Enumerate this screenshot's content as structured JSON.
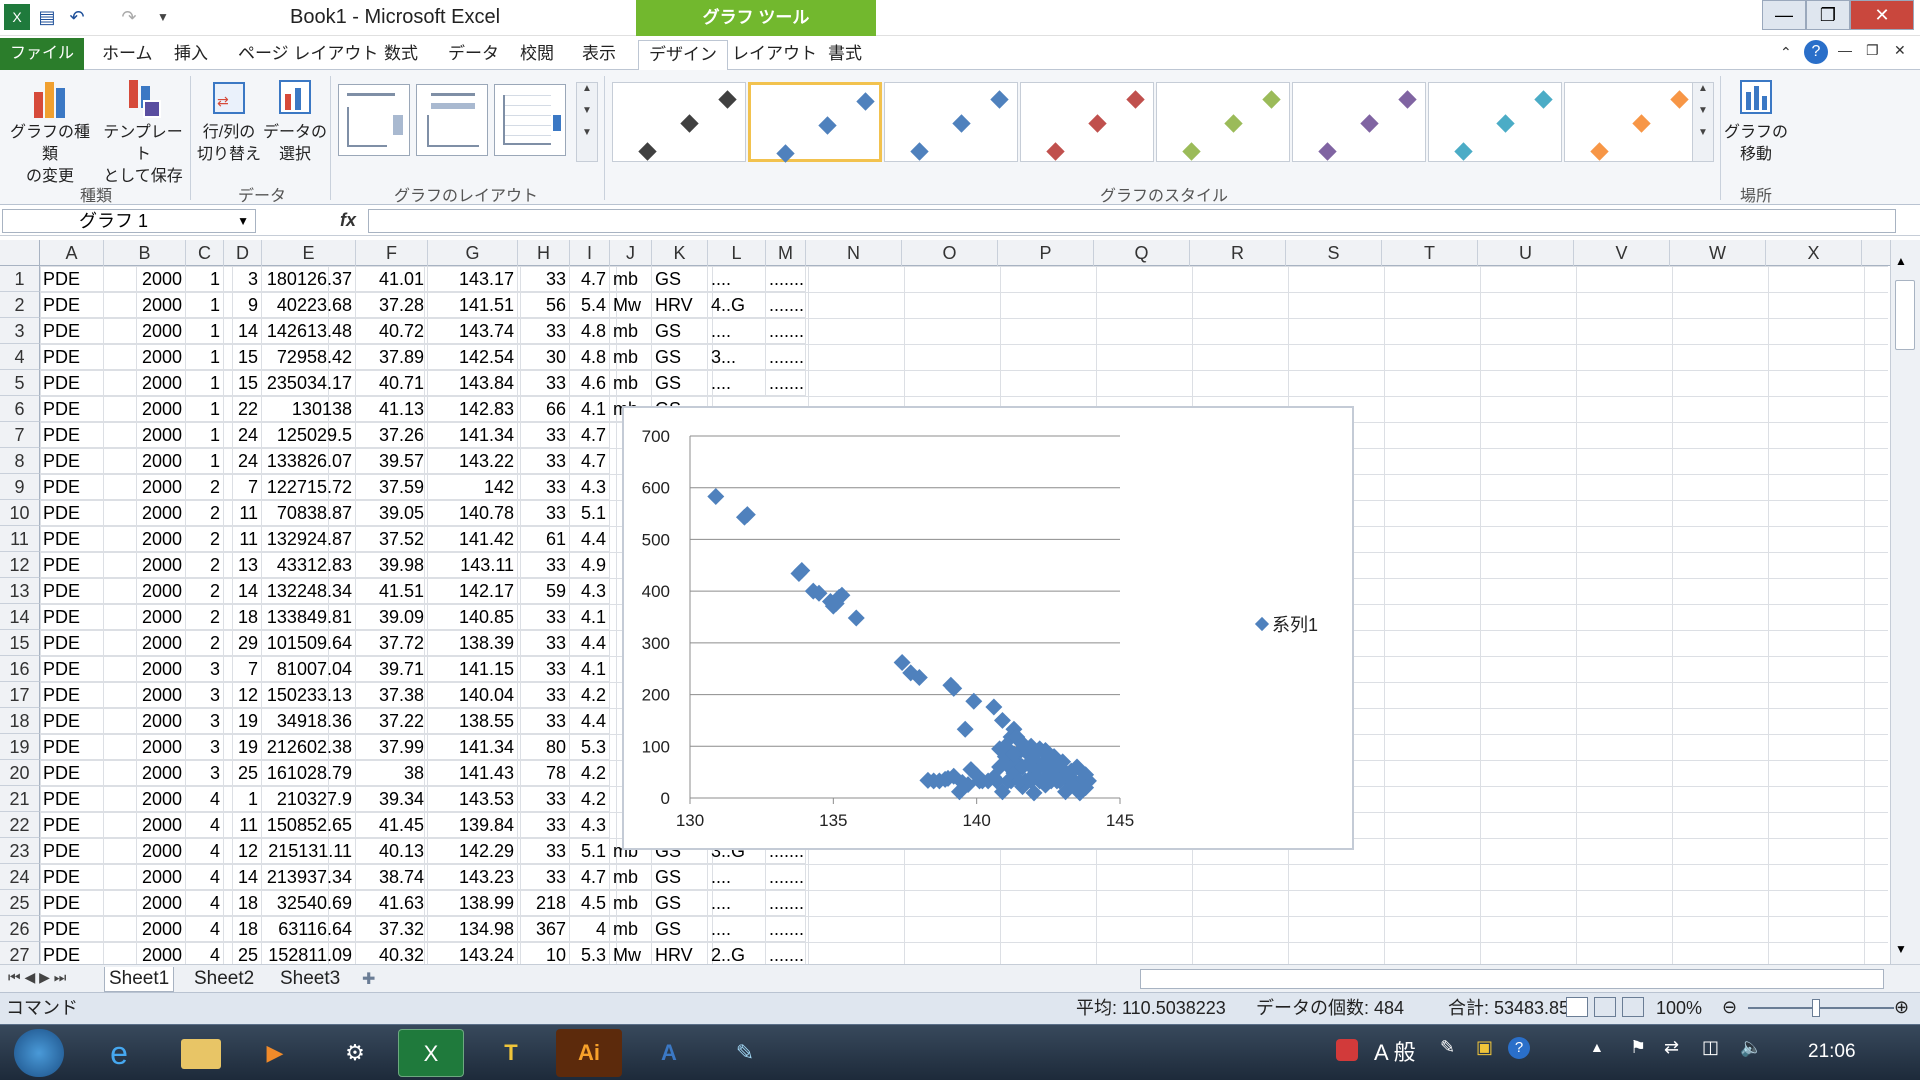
{
  "window": {
    "title": "Book1 - Microsoft Excel",
    "context_tab": "グラフ ツール"
  },
  "tabs": [
    "ファイル",
    "ホーム",
    "挿入",
    "ページ レイアウト",
    "数式",
    "データ",
    "校閲",
    "表示",
    "デザイン",
    "レイアウト",
    "書式"
  ],
  "ribbon": {
    "change_type": [
      "グラフの種類",
      "の変更"
    ],
    "save_template": [
      "テンプレート",
      "として保存"
    ],
    "switch_rowcol": [
      "行/列の",
      "切り替え"
    ],
    "select_data": [
      "データの",
      "選択"
    ],
    "move_chart": [
      "グラフの",
      "移動"
    ],
    "groups": {
      "type": "種類",
      "data": "データ",
      "layout": "グラフのレイアウト",
      "style": "グラフのスタイル",
      "location": "場所"
    },
    "style_colors": [
      "#404040",
      "#4f81bd",
      "#4f81bd",
      "#c0504d",
      "#9bbb59",
      "#8064a2",
      "#4bacc6",
      "#f79646"
    ]
  },
  "formula_bar": {
    "name_box": "グラフ 1",
    "fx": "fx"
  },
  "columns": [
    "A",
    "B",
    "C",
    "D",
    "E",
    "F",
    "G",
    "H",
    "I",
    "J",
    "K",
    "L",
    "M",
    "N",
    "O",
    "P",
    "Q",
    "R",
    "S",
    "T",
    "U",
    "V",
    "W",
    "X"
  ],
  "rows": [
    [
      "PDE",
      "2000",
      "1",
      "3",
      "180126.37",
      "41.01",
      "143.17",
      "33",
      "4.7",
      "mb",
      "GS",
      "....",
      "......."
    ],
    [
      "PDE",
      "2000",
      "1",
      "9",
      "40223.68",
      "37.28",
      "141.51",
      "56",
      "5.4",
      "Mw",
      "HRV",
      "4..G",
      "......."
    ],
    [
      "PDE",
      "2000",
      "1",
      "14",
      "142613.48",
      "40.72",
      "143.74",
      "33",
      "4.8",
      "mb",
      "GS",
      "....",
      "......."
    ],
    [
      "PDE",
      "2000",
      "1",
      "15",
      "72958.42",
      "37.89",
      "142.54",
      "30",
      "4.8",
      "mb",
      "GS",
      "3...",
      "......."
    ],
    [
      "PDE",
      "2000",
      "1",
      "15",
      "235034.17",
      "40.71",
      "143.84",
      "33",
      "4.6",
      "mb",
      "GS",
      "....",
      "......."
    ],
    [
      "PDE",
      "2000",
      "1",
      "22",
      "130138",
      "41.13",
      "142.83",
      "66",
      "4.1",
      "mb",
      "GS",
      "",
      ""
    ],
    [
      "PDE",
      "2000",
      "1",
      "24",
      "125029.5",
      "37.26",
      "141.34",
      "33",
      "4.7",
      "",
      "",
      "",
      ""
    ],
    [
      "PDE",
      "2000",
      "1",
      "24",
      "133826.07",
      "39.57",
      "143.22",
      "33",
      "4.7",
      "",
      "",
      "",
      ""
    ],
    [
      "PDE",
      "2000",
      "2",
      "7",
      "122715.72",
      "37.59",
      "142",
      "33",
      "4.3",
      "",
      "",
      "",
      ""
    ],
    [
      "PDE",
      "2000",
      "2",
      "11",
      "70838.87",
      "39.05",
      "140.78",
      "33",
      "5.1",
      "",
      "",
      "",
      ""
    ],
    [
      "PDE",
      "2000",
      "2",
      "11",
      "132924.87",
      "37.52",
      "141.42",
      "61",
      "4.4",
      "",
      "",
      "",
      ""
    ],
    [
      "PDE",
      "2000",
      "2",
      "13",
      "43312.83",
      "39.98",
      "143.11",
      "33",
      "4.9",
      "",
      "",
      "",
      ""
    ],
    [
      "PDE",
      "2000",
      "2",
      "14",
      "132248.34",
      "41.51",
      "142.17",
      "59",
      "4.3",
      "",
      "",
      "",
      ""
    ],
    [
      "PDE",
      "2000",
      "2",
      "18",
      "133849.81",
      "39.09",
      "140.85",
      "33",
      "4.1",
      "",
      "",
      "",
      ""
    ],
    [
      "PDE",
      "2000",
      "2",
      "29",
      "101509.64",
      "37.72",
      "138.39",
      "33",
      "4.4",
      "",
      "",
      "",
      ""
    ],
    [
      "PDE",
      "2000",
      "3",
      "7",
      "81007.04",
      "39.71",
      "141.15",
      "33",
      "4.1",
      "",
      "",
      "",
      ""
    ],
    [
      "PDE",
      "2000",
      "3",
      "12",
      "150233.13",
      "37.38",
      "140.04",
      "33",
      "4.2",
      "",
      "",
      "",
      ""
    ],
    [
      "PDE",
      "2000",
      "3",
      "19",
      "34918.36",
      "37.22",
      "138.55",
      "33",
      "4.4",
      "",
      "",
      "",
      ""
    ],
    [
      "PDE",
      "2000",
      "3",
      "19",
      "212602.38",
      "37.99",
      "141.34",
      "80",
      "5.3",
      "",
      "",
      "",
      ""
    ],
    [
      "PDE",
      "2000",
      "3",
      "25",
      "161028.79",
      "38",
      "141.43",
      "78",
      "4.2",
      "",
      "",
      "",
      ""
    ],
    [
      "PDE",
      "2000",
      "4",
      "1",
      "210327.9",
      "39.34",
      "143.53",
      "33",
      "4.2",
      "",
      "",
      "",
      ""
    ],
    [
      "PDE",
      "2000",
      "4",
      "11",
      "150852.65",
      "41.45",
      "139.84",
      "33",
      "4.3",
      "",
      "",
      "",
      ""
    ],
    [
      "PDE",
      "2000",
      "4",
      "12",
      "215131.11",
      "40.13",
      "142.29",
      "33",
      "5.1",
      "mb",
      "GS",
      "3..G",
      "......."
    ],
    [
      "PDE",
      "2000",
      "4",
      "14",
      "213937.34",
      "38.74",
      "143.23",
      "33",
      "4.7",
      "mb",
      "GS",
      "....",
      "......."
    ],
    [
      "PDE",
      "2000",
      "4",
      "18",
      "32540.69",
      "41.63",
      "138.99",
      "218",
      "4.5",
      "mb",
      "GS",
      "....",
      "......."
    ],
    [
      "PDE",
      "2000",
      "4",
      "18",
      "63116.64",
      "37.32",
      "134.98",
      "367",
      "4",
      "mb",
      "GS",
      "....",
      "......."
    ],
    [
      "PDE",
      "2000",
      "4",
      "25",
      "152811.09",
      "40.32",
      "143.24",
      "10",
      "5.3",
      "Mw",
      "HRV",
      "2..G",
      "......."
    ]
  ],
  "chart_data": {
    "type": "scatter",
    "xlim": [
      130,
      145
    ],
    "ylim": [
      0,
      700
    ],
    "xticks": [
      "130",
      "135",
      "140",
      "145"
    ],
    "yticks": [
      "0",
      "100",
      "200",
      "300",
      "400",
      "500",
      "600",
      "700"
    ],
    "grid": "horizontal",
    "legend_position": "right",
    "color": "#4f81bd",
    "series": [
      {
        "name": "系列1",
        "points": [
          [
            130.9,
            583
          ],
          [
            131.9,
            543
          ],
          [
            132.0,
            548
          ],
          [
            133.8,
            434
          ],
          [
            133.9,
            440
          ],
          [
            134.3,
            400
          ],
          [
            134.5,
            396
          ],
          [
            134.9,
            380
          ],
          [
            135.0,
            371
          ],
          [
            135.1,
            376
          ],
          [
            135.2,
            388
          ],
          [
            135.3,
            392
          ],
          [
            135.8,
            348
          ],
          [
            137.4,
            262
          ],
          [
            137.7,
            242
          ],
          [
            138.0,
            233
          ],
          [
            139.1,
            218
          ],
          [
            139.2,
            212
          ],
          [
            139.9,
            187
          ],
          [
            139.6,
            133
          ],
          [
            140.6,
            176
          ],
          [
            140.9,
            150
          ],
          [
            141.3,
            133
          ],
          [
            141.5,
            110
          ],
          [
            141.2,
            118
          ],
          [
            138.3,
            34
          ],
          [
            138.5,
            33
          ],
          [
            138.7,
            33
          ],
          [
            138.9,
            36
          ],
          [
            139.0,
            38
          ],
          [
            139.2,
            42
          ],
          [
            139.5,
            30
          ],
          [
            139.8,
            55
          ],
          [
            140.0,
            44
          ],
          [
            140.2,
            33
          ],
          [
            139.4,
            12
          ],
          [
            139.7,
            26
          ],
          [
            140.6,
            40
          ],
          [
            140.8,
            95
          ],
          [
            141.0,
            80
          ],
          [
            141.1,
            62
          ],
          [
            141.2,
            33
          ],
          [
            141.3,
            48
          ],
          [
            141.4,
            70
          ],
          [
            141.5,
            90
          ],
          [
            141.6,
            60
          ],
          [
            141.7,
            33
          ],
          [
            141.8,
            85
          ],
          [
            141.9,
            40
          ],
          [
            142.0,
            75
          ],
          [
            142.1,
            55
          ],
          [
            142.2,
            33
          ],
          [
            142.3,
            66
          ],
          [
            142.4,
            92
          ],
          [
            142.5,
            45
          ],
          [
            142.6,
            33
          ],
          [
            142.7,
            80
          ],
          [
            142.8,
            58
          ],
          [
            142.9,
            33
          ],
          [
            143.0,
            70
          ],
          [
            143.1,
            40
          ],
          [
            143.2,
            33
          ],
          [
            143.3,
            52
          ],
          [
            143.4,
            33
          ],
          [
            143.5,
            60
          ],
          [
            143.6,
            30
          ],
          [
            143.7,
            33
          ],
          [
            143.8,
            45
          ],
          [
            143.9,
            33
          ],
          [
            143.6,
            10
          ],
          [
            143.1,
            12
          ],
          [
            142.0,
            10
          ],
          [
            140.9,
            12
          ],
          [
            141.0,
            100
          ],
          [
            140.8,
            60
          ],
          [
            141.4,
            118
          ],
          [
            141.6,
            105
          ],
          [
            141.9,
            100
          ],
          [
            142.2,
            95
          ],
          [
            142.5,
            80
          ],
          [
            142.7,
            65
          ],
          [
            143.0,
            55
          ],
          [
            141.1,
            33
          ],
          [
            141.6,
            22
          ],
          [
            142.4,
            25
          ],
          [
            140.1,
            33
          ],
          [
            140.4,
            33
          ],
          [
            140.7,
            33
          ],
          [
            141.5,
            33
          ],
          [
            141.9,
            33
          ],
          [
            142.8,
            33
          ],
          [
            143.4,
            22
          ],
          [
            143.8,
            20
          ],
          [
            142.3,
            33
          ],
          [
            141.8,
            66
          ],
          [
            142.6,
            50
          ],
          [
            141.3,
            85
          ]
        ]
      }
    ]
  },
  "sheets": [
    "Sheet1",
    "Sheet2",
    "Sheet3"
  ],
  "status": {
    "mode": "コマンド",
    "average": "平均: 110.5038223",
    "count": "データの個数: 484",
    "sum": "合計: 53483.85",
    "zoom": "100%"
  },
  "taskbar": {
    "ime": "A 般",
    "clock": "21:06"
  }
}
